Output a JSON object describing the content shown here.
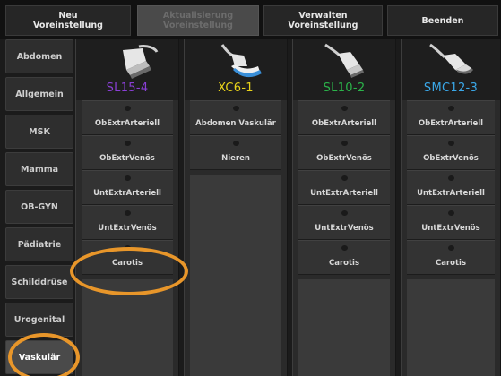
{
  "topbar": {
    "new_preset": "Neu\nVoreinstellung",
    "update_preset": "Aktualisierung\nVoreinstellung",
    "manage_preset": "Verwalten\nVoreinstellung",
    "quit": "Beenden"
  },
  "sidebar": {
    "items": [
      {
        "label": "Abdomen"
      },
      {
        "label": "Allgemein"
      },
      {
        "label": "MSK"
      },
      {
        "label": "Mamma"
      },
      {
        "label": "OB-GYN"
      },
      {
        "label": "Pädiatrie"
      },
      {
        "label": "Schilddrüse"
      },
      {
        "label": "Urogenital"
      },
      {
        "label": "Vaskulär"
      }
    ],
    "selected": "Vaskulär"
  },
  "transducers": [
    {
      "name": "SL15-4",
      "color": "#8a3fd6",
      "icon": "linear-probe-icon",
      "presets": [
        "ObExtrArteriell",
        "ObExtrVenös",
        "UntExtrArteriell",
        "UntExtrVenös",
        "Carotis"
      ]
    },
    {
      "name": "XC6-1",
      "color": "#e8d21a",
      "icon": "convex-probe-icon",
      "presets": [
        "Abdomen Vaskulär",
        "Nieren"
      ]
    },
    {
      "name": "SL10-2",
      "color": "#2bb34a",
      "icon": "linear-probe-icon",
      "presets": [
        "ObExtrArteriell",
        "ObExtrVenös",
        "UntExtrArteriell",
        "UntExtrVenös",
        "Carotis"
      ]
    },
    {
      "name": "SMC12-3",
      "color": "#3aa7e8",
      "icon": "microconvex-probe-icon",
      "presets": [
        "ObExtrArteriell",
        "ObExtrVenös",
        "UntExtrArteriell",
        "UntExtrVenös",
        "Carotis"
      ]
    }
  ],
  "colors": {
    "annotation": "#e8962a"
  }
}
